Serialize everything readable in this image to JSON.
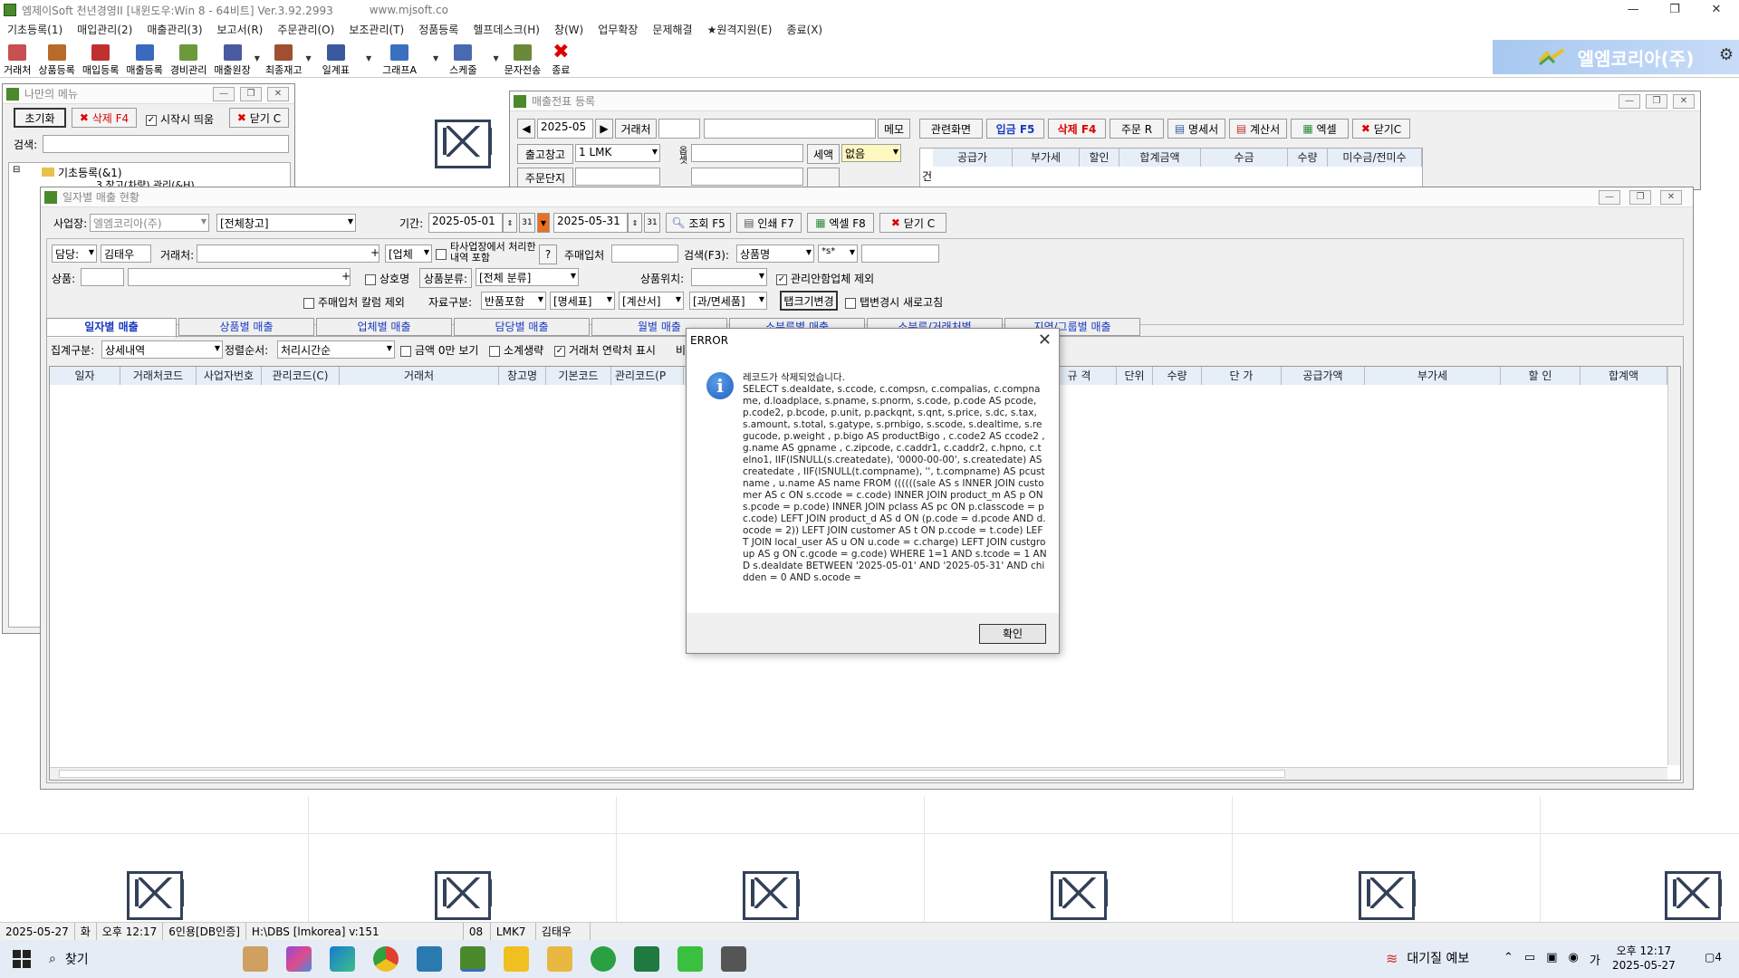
{
  "app": {
    "title": "엠제이Soft 천년경영II [내윈도우:Win 8 - 64비트] Ver.3.92.2993",
    "url": "www.mjsoft.co",
    "brand": "엘엠코리아(주)"
  },
  "menu": [
    "기초등록(1)",
    "매입관리(2)",
    "매출관리(3)",
    "보고서(R)",
    "주문관리(O)",
    "보조관리(T)",
    "정품등록",
    "헬프데스크(H)",
    "창(W)",
    "업무확장",
    "문제해결",
    "★원격지원(E)",
    "종료(X)"
  ],
  "toolbar": [
    {
      "label": "거래처",
      "icon": "client-icon",
      "color": "#c85050"
    },
    {
      "label": "상품등록",
      "icon": "product-icon",
      "color": "#b86a2a"
    },
    {
      "label": "매입등록",
      "icon": "purchase-icon",
      "color": "#c03030"
    },
    {
      "label": "매출등록",
      "icon": "sales-icon",
      "color": "#3a6ac0"
    },
    {
      "label": "경비관리",
      "icon": "expense-icon",
      "color": "#6a9a3a"
    },
    {
      "label": "매출원장",
      "icon": "ledger-icon",
      "color": "#4a5aa0"
    },
    {
      "label": "최종재고",
      "icon": "stock-icon",
      "color": "#a05030"
    },
    {
      "label": "일계표",
      "icon": "daily-icon",
      "color": "#3a5aa0"
    },
    {
      "label": "그래프A",
      "icon": "graph-icon",
      "color": "#3a70c0"
    },
    {
      "label": "스케줄",
      "icon": "schedule-icon",
      "color": "#4a6ab0"
    },
    {
      "label": "문자전송",
      "icon": "sms-icon",
      "color": "#6a8a3a"
    },
    {
      "label": "종료",
      "icon": "exit-icon",
      "color": "#dd0000"
    }
  ],
  "mymenu": {
    "title": "나만의 메뉴",
    "init_label": "초기화",
    "delete_label": "삭제 F4",
    "startup_label": "시작시 띄움",
    "close_label": "닫기 C",
    "search_label": "검색:",
    "tree_root": "기초등록(&1)",
    "tree_child": "3.창고(차량) 관리(&H)"
  },
  "slip": {
    "title": "매출전표 등록",
    "month": "2025-05",
    "client_label": "거래처",
    "memo_label": "메모",
    "related_label": "관련화면",
    "deposit_label": "입금 F5",
    "delete_label": "삭제 F4",
    "order_label": "주문 R",
    "statement_label": "명세서",
    "invoice_label": "계산서",
    "excel_label": "엑셀",
    "close_label": "닫기C",
    "warehouse_label": "출고창고",
    "warehouse_value": "1 LMK",
    "tax_label": "세액",
    "tax_value": "없음",
    "unit_label": "주문단지",
    "side_label": "옵셋",
    "cols": [
      "공급가",
      "부가세",
      "할인",
      "합계금액",
      "수금",
      "수량",
      "미수금/전미수"
    ],
    "row_labels": [
      "건"
    ]
  },
  "report": {
    "title": "일자별 매출 현황",
    "site_label": "사업장:",
    "site_value": "엘엠코리아(주)",
    "warehouse_value": "[전체창고]",
    "period_label": "기간:",
    "date_from": "2025-05-01",
    "date_to": "2025-05-31",
    "query_label": "조회 F5",
    "print_label": "인쇄 F7",
    "excel_label": "엑셀 F8",
    "close_label": "닫기 C",
    "manager_label": "담당:",
    "manager_value": "김태우",
    "client_label": "거래처:",
    "biz_value": "[업체",
    "other_site_label": "타사업장에서 처리한 내역 포함",
    "other_site_help": "?",
    "main_client_label": "주매입처",
    "search_label": "검색(F3):",
    "search_value": "상품명",
    "search_mode": "*s*",
    "product_label": "상품:",
    "plus": "+",
    "trade_name_label": "상호명",
    "category_btn": "상품분류:",
    "category_value": "[전체 분류]",
    "location_label": "상품위치:",
    "exclude_unmanaged": "관리안함업체 제외",
    "exclude_main_client_col": "주매입처 칼럼 제외",
    "data_kind_label": "자료구분:",
    "data_kind_value": "반품포함",
    "statement_value": "[명세표]",
    "invoice_value": "[계산서]",
    "tax_kind_value": "[과/면세품]",
    "tab_resize_label": "탭크기변경",
    "refresh_on_tab": "탭변경시 새로고침",
    "tabs": [
      "일자별 매출",
      "상품별 매출",
      "업체별 매출",
      "담당별 매출",
      "월별 매출",
      "소분류별 매출",
      "소분류/거래처별",
      "지역/그룹별 매출"
    ],
    "agg_label": "집계구분:",
    "agg_value": "상세내역",
    "sort_label": "정렬순서:",
    "sort_value": "처리시간순",
    "amount_zero_label": "금액 0만 보기",
    "subtotal_omit_label": "소계생략",
    "client_contact_label": "거래처 연락처 표시",
    "compare_label": "비교",
    "columns_left": [
      "일자",
      "거래처코드",
      "사업자번호",
      "관리코드(C)",
      "거래처",
      "창고명",
      "기본코드",
      "관리코드(P"
    ],
    "columns_right": [
      "규 격",
      "단위",
      "수량",
      "단 가",
      "공급가액",
      "부가세",
      "할 인",
      "합계액"
    ]
  },
  "dialog": {
    "title": "ERROR",
    "heading": "레코드가 삭제되었습니다.",
    "message": "SELECT s.dealdate, s.ccode, c.compsn, c.compalias, c.compname, d.loadplace, s.pname, s.pnorm, s.code, p.code AS pcode, p.code2, p.bcode, p.unit, p.packqnt, s.qnt, s.price, s.dc, s.tax, s.amount, s.total, s.gatype, s.prnbigo, s.scode, s.dealtime, s.regucode, p.weight , p.bigo AS productBigo , c.code2 AS ccode2 , g.name AS gpname , c.zipcode, c.caddr1, c.caddr2, c.hpno, c.telno1, IIF(ISNULL(s.createdate), '0000-00-00', s.createdate) AS createdate , IIF(ISNULL(t.compname), '', t.compname) AS pcustname , u.name AS name  FROM ((((((sale AS s INNER JOIN customer AS c ON s.ccode = c.code) INNER JOIN product_m AS p ON s.pcode = p.code) INNER JOIN pclass AS pc ON p.classcode = pc.code) LEFT JOIN product_d AS d ON (p.code = d.pcode AND d.ocode = 2)) LEFT JOIN customer AS t ON p.ccode = t.code) LEFT JOIN local_user AS u ON u.code = c.charge) LEFT JOIN custgroup AS g ON c.gcode = g.code)  WHERE 1=1 AND s.tcode = 1 AND s.dealdate BETWEEN '2025-05-01' AND '2025-05-31' AND chidden = 0 AND s.ocode =",
    "ok_label": "확인"
  },
  "status": {
    "date": "2025-05-27",
    "weekday": "화",
    "time": "오후 12:17",
    "license": "6인용[DB인증]",
    "db": "H:\\DBS [lmkorea] v:151",
    "code": "08",
    "warehouse": "LMK7",
    "user": "김태우"
  },
  "taskbar": {
    "search_label": "찾기",
    "weather": "대기질 예보",
    "time": "오후 12:17",
    "date": "2025-05-27",
    "notif": "4"
  }
}
